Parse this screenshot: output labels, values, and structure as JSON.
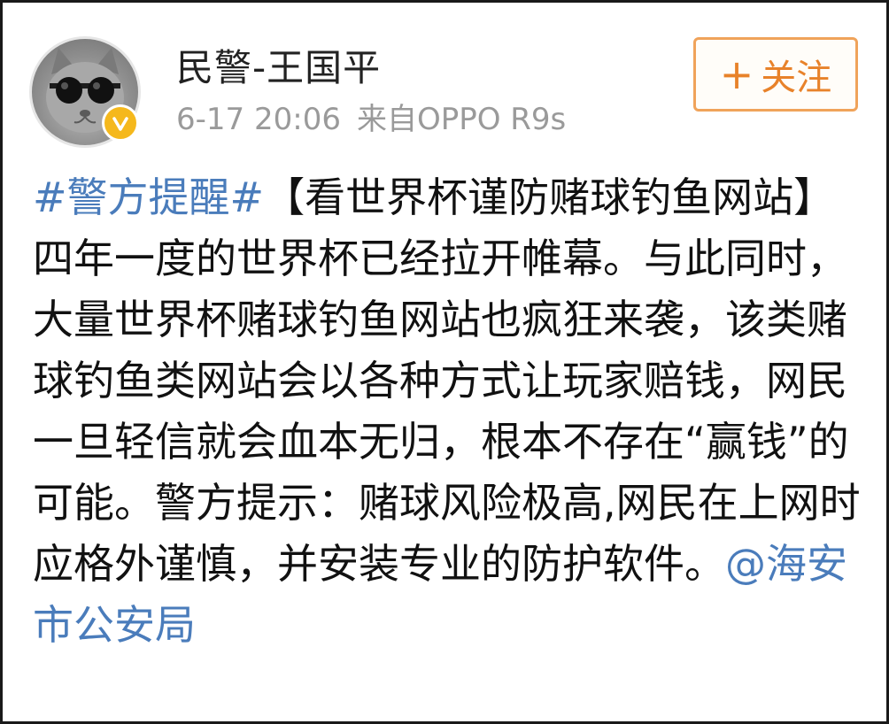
{
  "user": {
    "name": "民警-王国平",
    "timestamp": "6-17 20:06",
    "source": "来自OPPO R9s",
    "verified_color": "#f5b81c"
  },
  "follow_button": {
    "icon": "+",
    "label": "关注",
    "color": "#e8822a"
  },
  "post": {
    "hashtag": "#警方提醒#",
    "body": "【看世界杯谨防赌球钓鱼网站】四年一度的世界杯已经拉开帷幕。与此同时，大量世界杯赌球钓鱼网站也疯狂来袭，该类赌球钓鱼类网站会以各种方式让玩家赔钱，网民一旦轻信就会血本无归，根本不存在“赢钱”的可能。警方提示：赌球风险极高,网民在上网时应格外谨慎，并安装专业的防护软件。",
    "mention": "@海安市公安局",
    "link_color": "#4a7cbb"
  }
}
